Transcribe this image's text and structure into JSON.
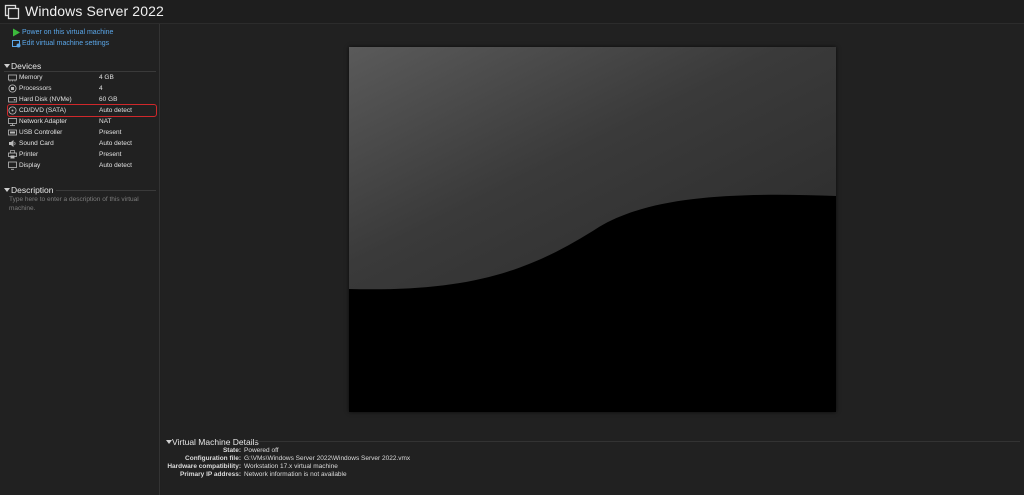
{
  "window": {
    "title": "Windows Server 2022"
  },
  "actions": {
    "power_on": "Power on this virtual machine",
    "edit_settings": "Edit virtual machine settings"
  },
  "devices": {
    "header": "Devices",
    "items": [
      {
        "name": "Memory",
        "value": "4 GB",
        "icon": "memory-icon"
      },
      {
        "name": "Processors",
        "value": "4",
        "icon": "processor-icon"
      },
      {
        "name": "Hard Disk (NVMe)",
        "value": "60 GB",
        "icon": "hard-disk-icon"
      },
      {
        "name": "CD/DVD (SATA)",
        "value": "Auto detect",
        "icon": "cd-dvd-icon",
        "highlighted": true
      },
      {
        "name": "Network Adapter",
        "value": "NAT",
        "icon": "network-adapter-icon"
      },
      {
        "name": "USB Controller",
        "value": "Present",
        "icon": "usb-controller-icon"
      },
      {
        "name": "Sound Card",
        "value": "Auto detect",
        "icon": "sound-card-icon"
      },
      {
        "name": "Printer",
        "value": "Present",
        "icon": "printer-icon"
      },
      {
        "name": "Display",
        "value": "Auto detect",
        "icon": "display-icon"
      }
    ]
  },
  "description": {
    "header": "Description",
    "placeholder": "Type here to enter a description of this virtual machine."
  },
  "vm_details": {
    "header": "Virtual Machine Details",
    "rows": [
      {
        "key": "State:",
        "value": "Powered off"
      },
      {
        "key": "Configuration file:",
        "value": "G:\\VMs\\Windows Server 2022\\Windows Server 2022.vmx"
      },
      {
        "key": "Hardware compatibility:",
        "value": "Workstation 17.x virtual machine"
      },
      {
        "key": "Primary IP address:",
        "value": "Network information is not available"
      }
    ]
  },
  "colors": {
    "background": "#202020",
    "link": "#5aa6e8",
    "highlight_border": "#d0282b",
    "power_green": "#3cba3c"
  }
}
